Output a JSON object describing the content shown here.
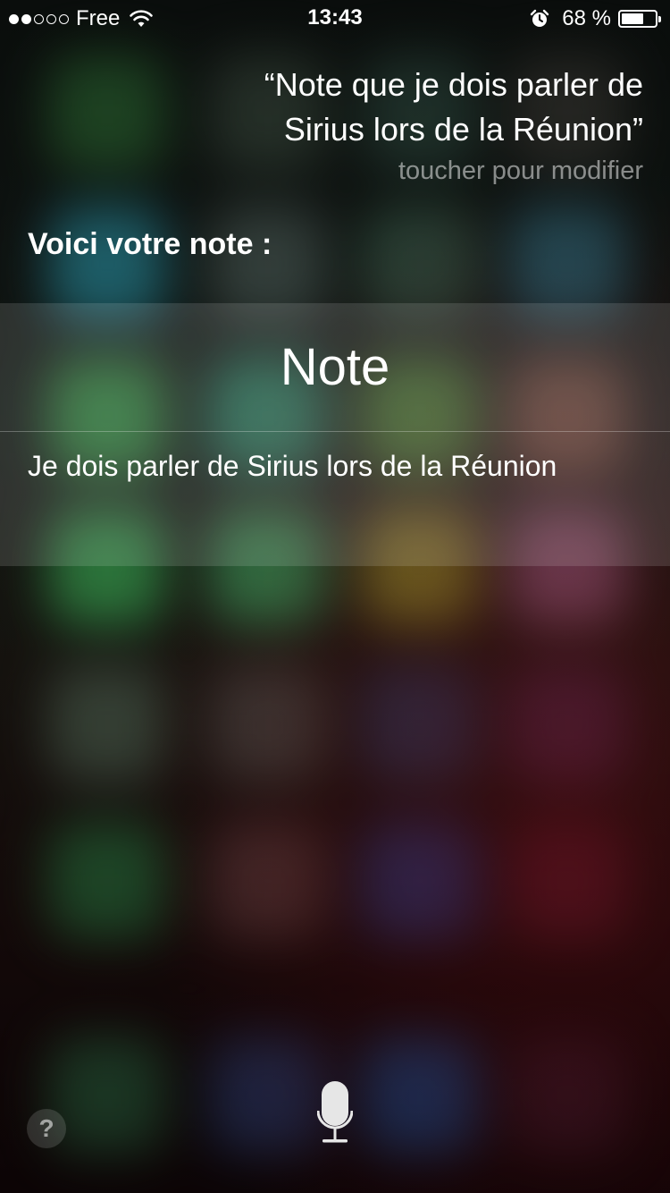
{
  "status_bar": {
    "carrier": "Free",
    "signal_bars_filled": 2,
    "signal_bars_total": 5,
    "time": "13:43",
    "battery_percent_label": "68 %",
    "battery_level": 0.68,
    "icons": [
      "wifi-icon",
      "alarm-icon",
      "battery-icon"
    ]
  },
  "siri": {
    "query_line1": "“Note que je dois parler de",
    "query_line2": "Sirius lors de la Réunion”",
    "tap_to_edit": "toucher pour modifier",
    "response": "Voici votre note :"
  },
  "note_card": {
    "title": "Note",
    "body": "Je dois parler de Sirius lors de la Réunion"
  },
  "controls": {
    "help_label": "?",
    "mic_icon": "microphone-icon"
  },
  "colors": {
    "text_primary": "#ffffff",
    "text_secondary": "rgba(255,255,255,0.5)",
    "card_background": "rgba(255,255,255,0.13)"
  }
}
